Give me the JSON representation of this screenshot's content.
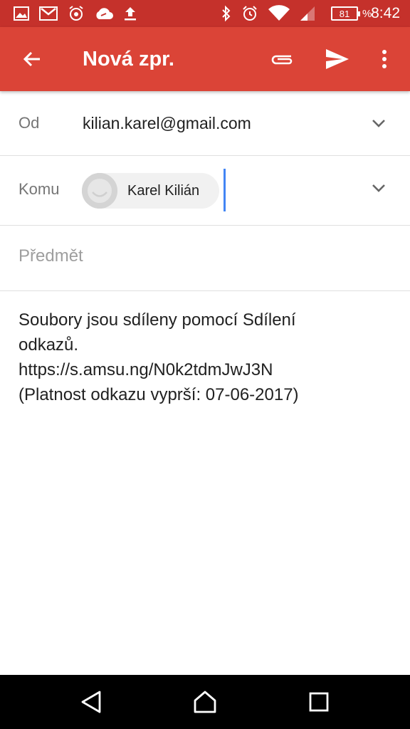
{
  "status_bar": {
    "time": "8:42",
    "battery": "81",
    "battery_suffix": "%",
    "left_icons": [
      "gallery-icon",
      "gmail-icon",
      "alarm-clock-app-icon",
      "cloud-link-icon",
      "upload-icon"
    ],
    "right_icons": [
      "bluetooth-icon",
      "alarm-icon",
      "wifi-icon",
      "cell-signal-icon",
      "battery-icon"
    ]
  },
  "app_bar": {
    "title": "Nová zpr.",
    "color": "#db4437",
    "actions": [
      "back-arrow-icon",
      "attach-icon",
      "send-icon",
      "more-vert-icon"
    ]
  },
  "form": {
    "from_label": "Od",
    "from_value": "kilian.karel@gmail.com",
    "to_label": "Komu",
    "to_chip": "Karel Kilián",
    "subject_placeholder": "Předmět",
    "body_lines": [
      "Soubory jsou sdíleny pomocí Sdílení",
      "odkazů.",
      "https://s.amsu.ng/N0k2tdmJwJ3N",
      "(Platnost odkazu vyprší: 07-06-2017)"
    ]
  },
  "nav_bar": {
    "buttons": [
      "back-nav-icon",
      "home-icon",
      "recents-icon"
    ]
  }
}
